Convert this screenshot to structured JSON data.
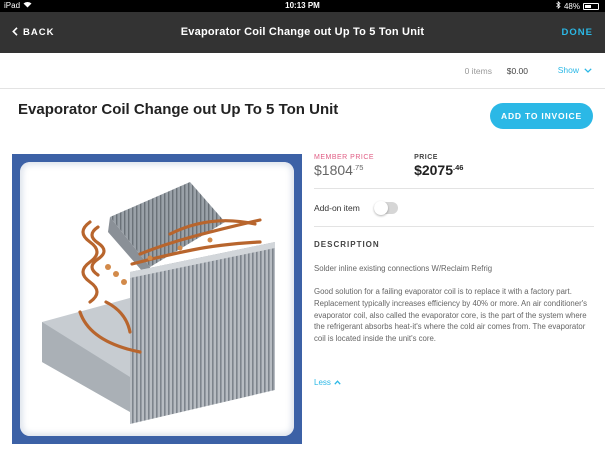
{
  "status_bar": {
    "device": "iPad",
    "time": "10:13 PM",
    "battery_text": "48%",
    "battery_level": 0.48
  },
  "nav": {
    "back_label": "BACK",
    "title": "Evaporator Coil Change out Up To 5 Ton Unit",
    "done_label": "DONE"
  },
  "summary": {
    "items": "0 items",
    "total": "$0.00",
    "show_label": "Show"
  },
  "product": {
    "title": "Evaporator Coil Change out Up To 5 Ton Unit",
    "add_button": "ADD TO INVOICE",
    "member_price_label": "MEMBER PRICE",
    "member_price_dollars": "$1804",
    "member_price_cents": ".75",
    "price_label": "PRICE",
    "price_dollars": "$2075",
    "price_cents": ".46",
    "addon_label": "Add-on item",
    "addon_enabled": false,
    "description_heading": "DESCRIPTION",
    "description_short": "Solder inline existing connections W/Reclaim Refrig",
    "description_long": "Good solution for a failing evaporator coil is to replace it with a factory part. Replacement typically increases efficiency by 40% or more. An air conditioner's evaporator coil, also called the evaporator core, is the part of the system where the refrigerant absorbs heat-it's where the cold air comes from. The evaporator coil is located inside the unit's core.",
    "less_label": "Less"
  },
  "colors": {
    "accent": "#2bb8e6",
    "nav_bg": "#333333",
    "member_label": "#e05d84",
    "image_frame": "#3c61a6"
  }
}
